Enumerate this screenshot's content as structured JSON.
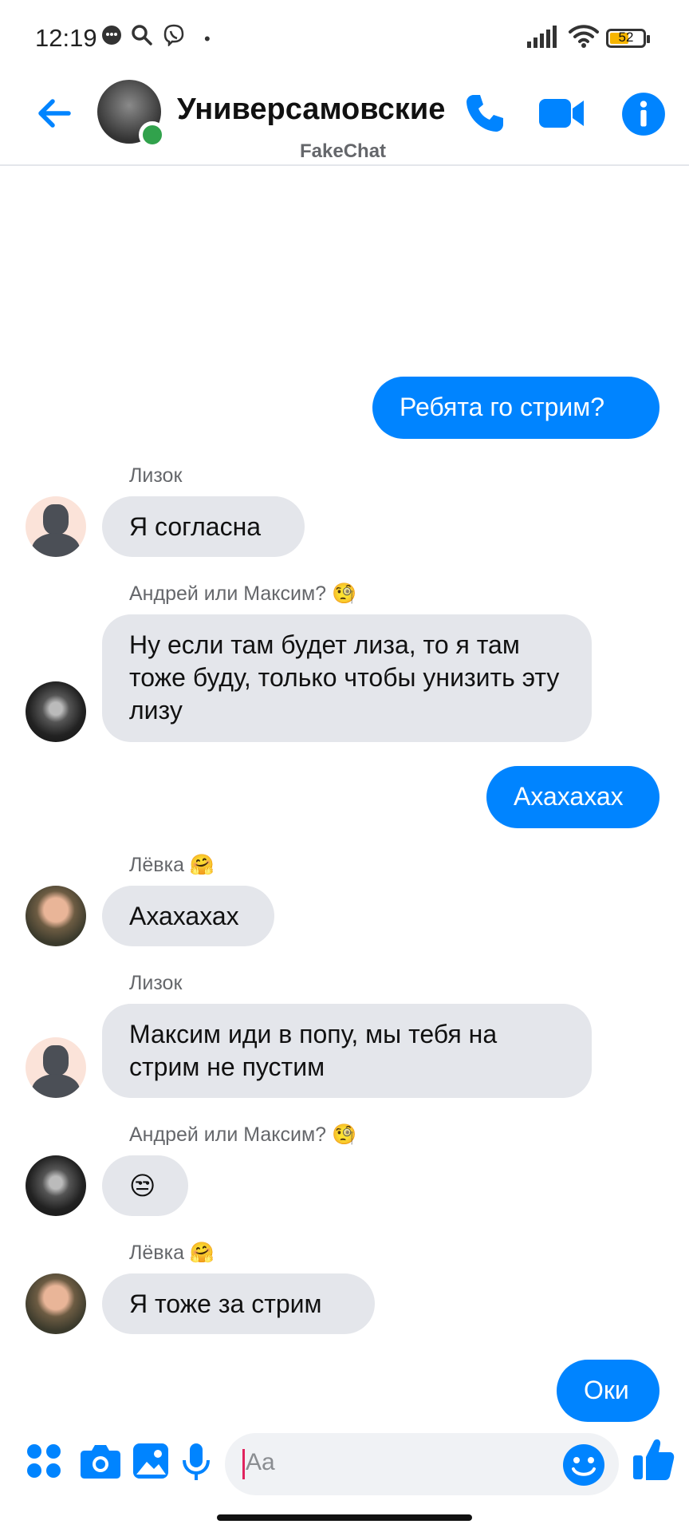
{
  "status_bar": {
    "time": "12:19",
    "battery": "52",
    "dot": "•",
    "icons": [
      "chat-bubble-icon",
      "search-icon",
      "viber-icon",
      "signal-icon",
      "wifi-icon",
      "battery-icon"
    ]
  },
  "header": {
    "title": "Универсамовские",
    "subtitle": "FakeChat",
    "accent_color": "#0084ff",
    "icons": [
      "back-arrow-icon",
      "phone-icon",
      "video-camera-icon",
      "info-icon"
    ]
  },
  "messages": [
    {
      "direction": "out",
      "text": "Ребята го стрим?"
    },
    {
      "direction": "in",
      "sender": "Лизок",
      "text": "Я согласна"
    },
    {
      "direction": "in",
      "sender": "Андрей или Максим? 🧐",
      "text": "Ну если там будет лиза, то я там тоже буду, только чтобы унизить эту лизу"
    },
    {
      "direction": "out",
      "text": "Ахахахах"
    },
    {
      "direction": "in",
      "sender": "Лёвка 🤗",
      "text": "Ахахахах"
    },
    {
      "direction": "in",
      "sender": "Лизок",
      "text": "Максим иди в попу, мы тебя на стрим не пустим"
    },
    {
      "direction": "in",
      "sender": "Андрей или Максим? 🧐",
      "text": "😒"
    },
    {
      "direction": "in",
      "sender": "Лёвка 🤗",
      "text": "Я тоже за стрим"
    },
    {
      "direction": "out",
      "text": "Оки"
    }
  ],
  "composer": {
    "placeholder": "Aa",
    "icons": [
      "apps-grid-icon",
      "camera-icon",
      "gallery-icon",
      "microphone-icon",
      "emoji-icon",
      "thumbs-up-icon"
    ]
  }
}
